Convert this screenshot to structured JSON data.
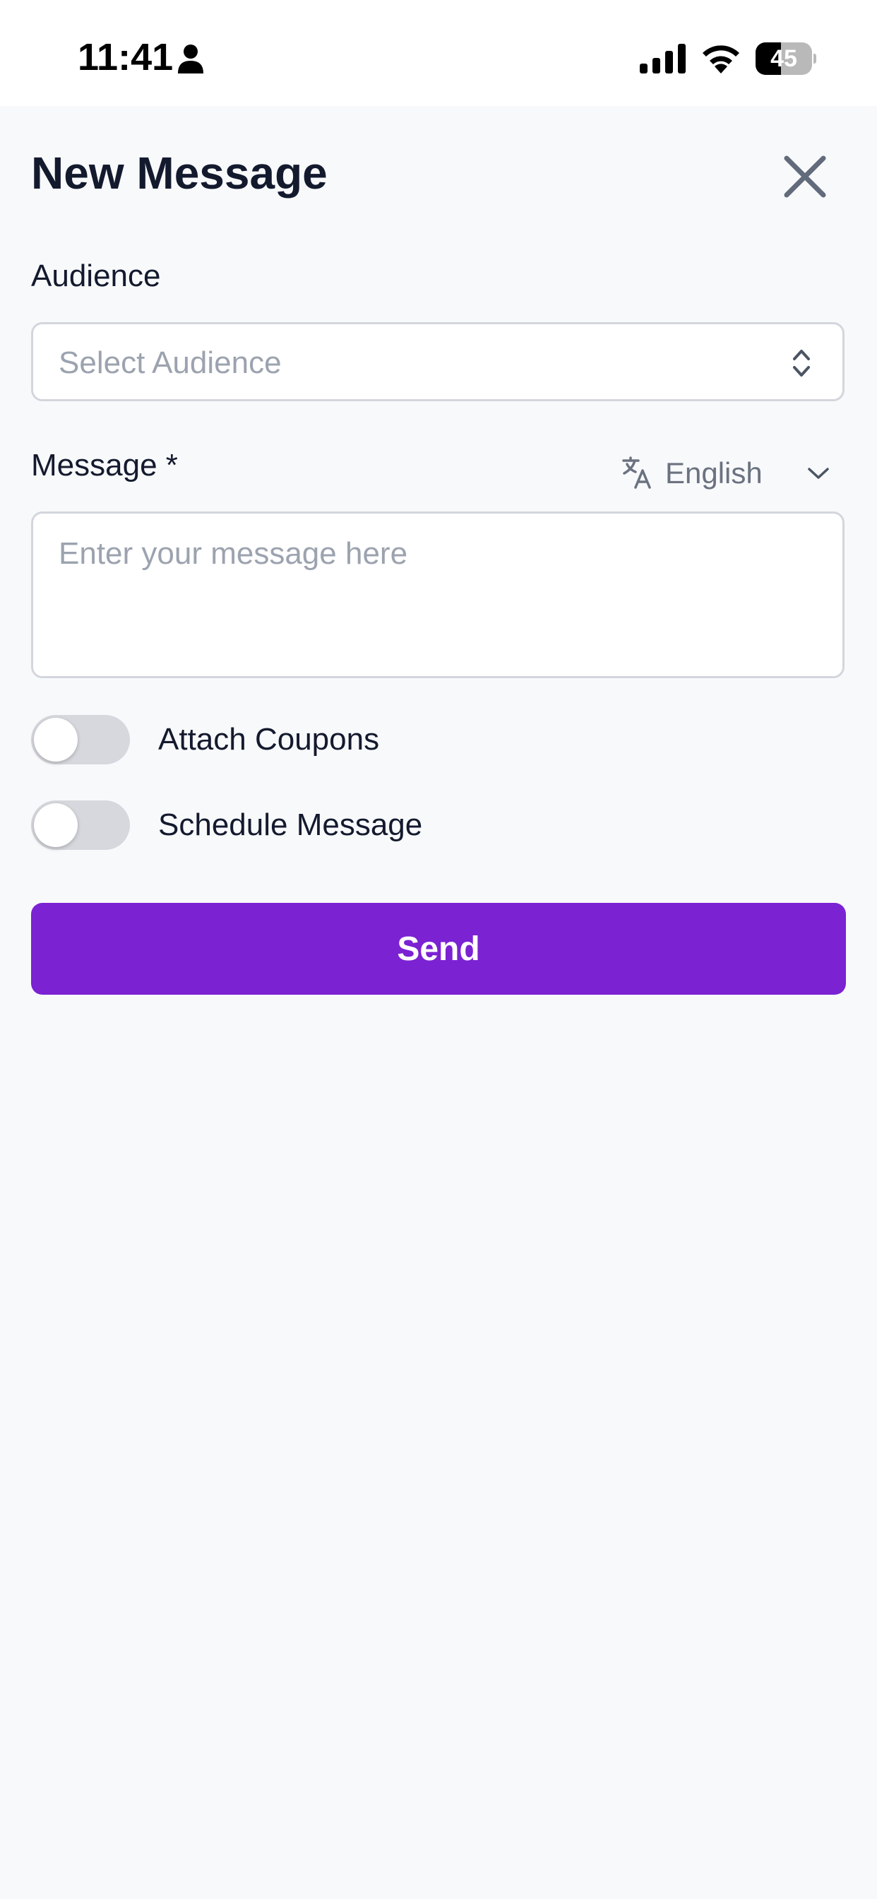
{
  "status_bar": {
    "time": "11:41",
    "battery_level": "45",
    "battery_percent": 45,
    "icons": [
      "person-icon",
      "signal-icon",
      "wifi-icon",
      "battery-icon"
    ]
  },
  "header": {
    "title": "New Message",
    "close_icon": "close-icon"
  },
  "audience": {
    "label": "Audience",
    "placeholder": "Select Audience",
    "icon": "updown-chevron-icon"
  },
  "message": {
    "label": "Message *",
    "placeholder": "Enter your message here",
    "language": "English",
    "language_icon": "translate-icon"
  },
  "options": {
    "attach_coupons": {
      "label": "Attach Coupons",
      "enabled": false
    },
    "schedule_message": {
      "label": "Schedule Message",
      "enabled": false
    }
  },
  "actions": {
    "send_label": "Send"
  },
  "colors": {
    "accent": "#7b22d3",
    "background": "#f8f9fb",
    "toggle_off": "#d6d8dd",
    "placeholder": "#9ca3af",
    "text": "#141a2e"
  }
}
